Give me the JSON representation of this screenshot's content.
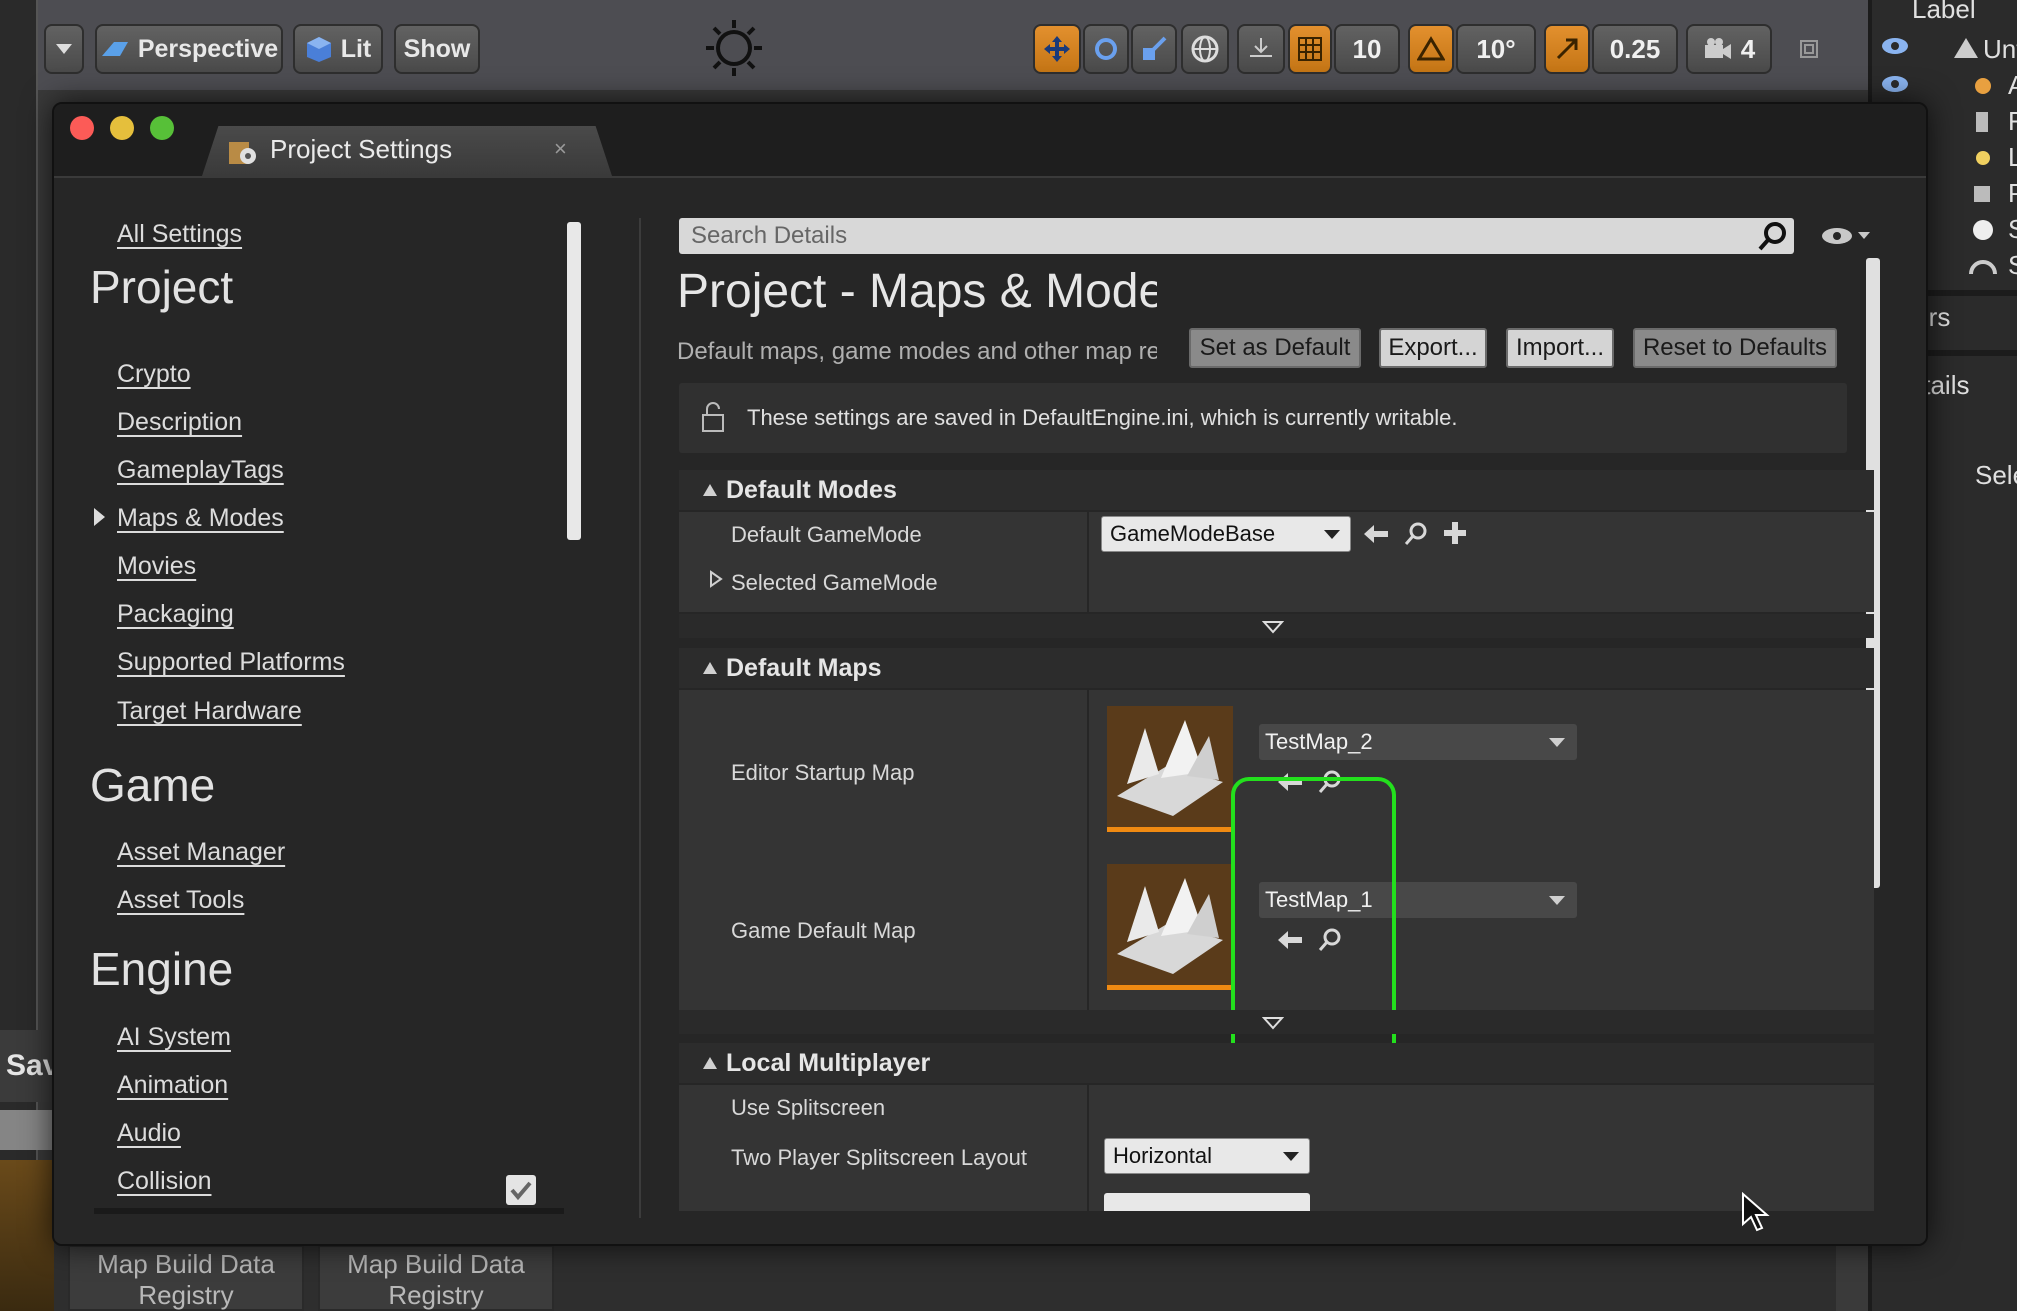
{
  "viewport_toolbar": {
    "perspective_label": "Perspective",
    "lit_label": "Lit",
    "show_label": "Show",
    "grid_snap_value": "10",
    "rotation_snap_value": "10°",
    "scale_snap_value": "0.25",
    "camera_speed_value": "4"
  },
  "right_panel": {
    "label_header": "Label",
    "row1": "Unt",
    "row2": "A",
    "row3": "F",
    "row4": "L",
    "row5": "P",
    "row6": "S",
    "row7": "S",
    "actors_text": "ctors",
    "details_text": "Details",
    "select_text": "Sele"
  },
  "bottom_tabs": {
    "tab1": "Map Build Data Registry",
    "tab2": "Map Build Data Registry"
  },
  "save_fragment": "Sav",
  "window": {
    "tab_title": "Project Settings",
    "tab_close": "×"
  },
  "sidebar": {
    "all_settings": "All Settings",
    "project_header": "Project",
    "project_items": [
      "Crypto",
      "Description",
      "GameplayTags",
      "Maps & Modes",
      "Movies",
      "Packaging",
      "Supported Platforms",
      "Target Hardware"
    ],
    "game_header": "Game",
    "game_items": [
      "Asset Manager",
      "Asset Tools"
    ],
    "engine_header": "Engine",
    "engine_items": [
      "AI System",
      "Animation",
      "Audio",
      "Collision"
    ]
  },
  "details": {
    "search_placeholder": "Search Details",
    "title": "Project - Maps & Modes",
    "subtitle": "Default maps, game modes and other map related settings.",
    "buttons": {
      "set_default": "Set as Default",
      "export": "Export...",
      "import": "Import...",
      "reset": "Reset to Defaults"
    },
    "notice": "These settings are saved in DefaultEngine.ini, which is currently writable.",
    "default_modes": {
      "header": "Default Modes",
      "default_gamemode_label": "Default GameMode",
      "default_gamemode_value": "GameModeBase",
      "selected_gamemode_label": "Selected GameMode"
    },
    "default_maps": {
      "header": "Default Maps",
      "editor_startup_label": "Editor Startup Map",
      "editor_startup_value": "TestMap_2",
      "game_default_label": "Game Default Map",
      "game_default_value": "TestMap_1"
    },
    "local_multiplayer": {
      "header": "Local Multiplayer",
      "use_splitscreen_label": "Use Splitscreen",
      "use_splitscreen_checked": true,
      "two_player_label": "Two Player Splitscreen Layout",
      "two_player_value": "Horizontal"
    }
  },
  "colors": {
    "highlight": "#23e01d",
    "toolbar_orange": "#e3902e",
    "thumb_underline": "#f08a12"
  }
}
